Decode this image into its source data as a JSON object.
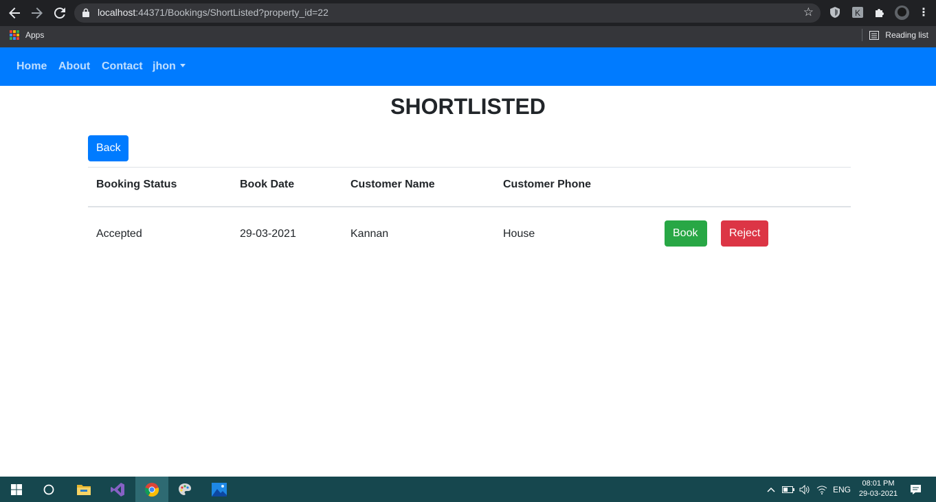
{
  "browser": {
    "url_host": "localhost",
    "url_path": ":44371/Bookings/ShortListed?property_id=22",
    "bookmarks_apps_label": "Apps",
    "reading_list_label": "Reading list"
  },
  "navbar": {
    "home": "Home",
    "about": "About",
    "contact": "Contact",
    "user": "jhon"
  },
  "page": {
    "title": "SHORTLISTED",
    "back_label": "Back"
  },
  "table": {
    "headers": [
      "Booking Status",
      "Book Date",
      "Customer Name",
      "Customer Phone"
    ],
    "rows": [
      {
        "status": "Accepted",
        "date": "29-03-2021",
        "name": "Kannan",
        "phone": "House",
        "book_label": "Book",
        "reject_label": "Reject"
      }
    ]
  },
  "taskbar": {
    "lang": "ENG",
    "time": "08:01 PM",
    "date": "29-03-2021"
  },
  "colors": {
    "primary": "#007bff",
    "success": "#28a745",
    "danger": "#dc3545",
    "taskbar": "#16474e"
  }
}
